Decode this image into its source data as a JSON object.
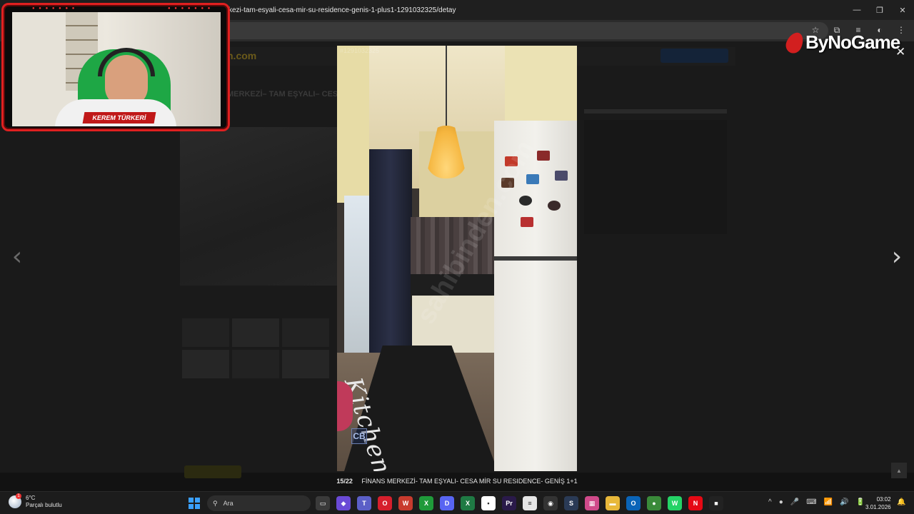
{
  "browser": {
    "url": "kezi-tam-esyali-cesa-mir-su-residence-genis-1-plus1-1291032325/detay",
    "controls": {
      "minimize": "—",
      "restore": "❐",
      "close": "✕"
    },
    "toolbar_icons": [
      "star-icon",
      "extensions-icon",
      "media-icon",
      "profile-icon",
      "menu-icon"
    ]
  },
  "page": {
    "logo": "n.com",
    "title": "MERKEZİ– TAM EŞYALI– CESA"
  },
  "lightbox": {
    "listing_id": "#1291032325",
    "counter": "15/22",
    "caption": "FİNANS MERKEZİ- TAM EŞYALI- CESA MİR SU RESIDENCE- GENİŞ 1+1",
    "top_actions": [
      "Tam ekran",
      "Kapat"
    ],
    "prev_glyph": "‹",
    "next_glyph": "›",
    "close_glyph": "✕",
    "photo_watermark": "sahibinden.com",
    "rug_text": "Kitchen",
    "badge": "CB"
  },
  "brand": {
    "name": "ByNoGame",
    "color": "#d21f1f"
  },
  "webcam": {
    "name": "KEREM TÜRKERİ",
    "frame_color": "#e02020"
  },
  "taskbar": {
    "weather": {
      "temp": "6°C",
      "desc": "Parçalı bulutlu",
      "badge": "1"
    },
    "search_placeholder": "Ara",
    "apps": [
      {
        "name": "file-explorer-app",
        "glyph": "▭",
        "color": "#3a3a3a"
      },
      {
        "name": "copilot-app",
        "glyph": "◆",
        "color": "#6a4ad6"
      },
      {
        "name": "teams-app",
        "glyph": "T",
        "color": "#5b5fc7"
      },
      {
        "name": "opera-app",
        "glyph": "O",
        "color": "#d61f2c"
      },
      {
        "name": "wps-app",
        "glyph": "W",
        "color": "#c83b2e"
      },
      {
        "name": "xbox-app",
        "glyph": "X",
        "color": "#1f9a3a"
      },
      {
        "name": "discord-app",
        "glyph": "D",
        "color": "#5865f2"
      },
      {
        "name": "excel-app",
        "glyph": "X",
        "color": "#1f7a44"
      },
      {
        "name": "epic-app",
        "glyph": "•",
        "color": "#ffffff"
      },
      {
        "name": "premiere-app",
        "glyph": "Pr",
        "color": "#2a1a4a"
      },
      {
        "name": "notepad-app",
        "glyph": "≡",
        "color": "#e6e6e6"
      },
      {
        "name": "obs-app",
        "glyph": "◉",
        "color": "#333333"
      },
      {
        "name": "steam-app",
        "glyph": "S",
        "color": "#2a3a55"
      },
      {
        "name": "photos-app",
        "glyph": "▦",
        "color": "#d04a8a"
      },
      {
        "name": "explorer-folder-app",
        "glyph": "▬",
        "color": "#e8b83a"
      },
      {
        "name": "outlook-app",
        "glyph": "O",
        "color": "#0a64b8"
      },
      {
        "name": "chrome-app",
        "glyph": "●",
        "color": "#3a8a3a"
      },
      {
        "name": "whatsapp-app",
        "glyph": "W",
        "color": "#25d366"
      },
      {
        "name": "netflix-app",
        "glyph": "N",
        "color": "#e50914"
      },
      {
        "name": "dark-app",
        "glyph": "■",
        "color": "#222222"
      }
    ],
    "tray_icons": [
      "^",
      "●",
      "🎤",
      "⌨",
      "📶",
      "🔊",
      "🔋"
    ],
    "time": "03:02",
    "date": "3.01.2026"
  }
}
